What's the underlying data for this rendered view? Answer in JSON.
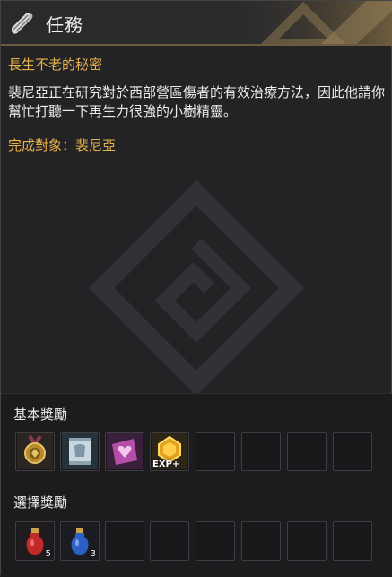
{
  "header": {
    "title": "任務",
    "icon": "scroll-icon"
  },
  "quest": {
    "name": "長生不老的秘密",
    "description": "裴尼亞正在研究對於西部營區傷者的有效治療方法，因此他請你幫忙打聽一下再生力很強的小樹精靈。",
    "objective": "完成對象：裴尼亞"
  },
  "rewards": {
    "basic_label": "基本獎勵",
    "choice_label": "選擇獎勵",
    "basic_items": [
      {
        "icon": "medal-icon"
      },
      {
        "icon": "armor-scroll-icon"
      },
      {
        "icon": "heart-card-icon"
      },
      {
        "icon": "exp-gem-icon",
        "label": "EXP+"
      }
    ],
    "choice_items": [
      {
        "icon": "red-potion-icon",
        "count": "5"
      },
      {
        "icon": "blue-potion-icon",
        "count": "3"
      }
    ]
  },
  "colors": {
    "accent_gold": "#e8b24a",
    "background": "#232326"
  }
}
